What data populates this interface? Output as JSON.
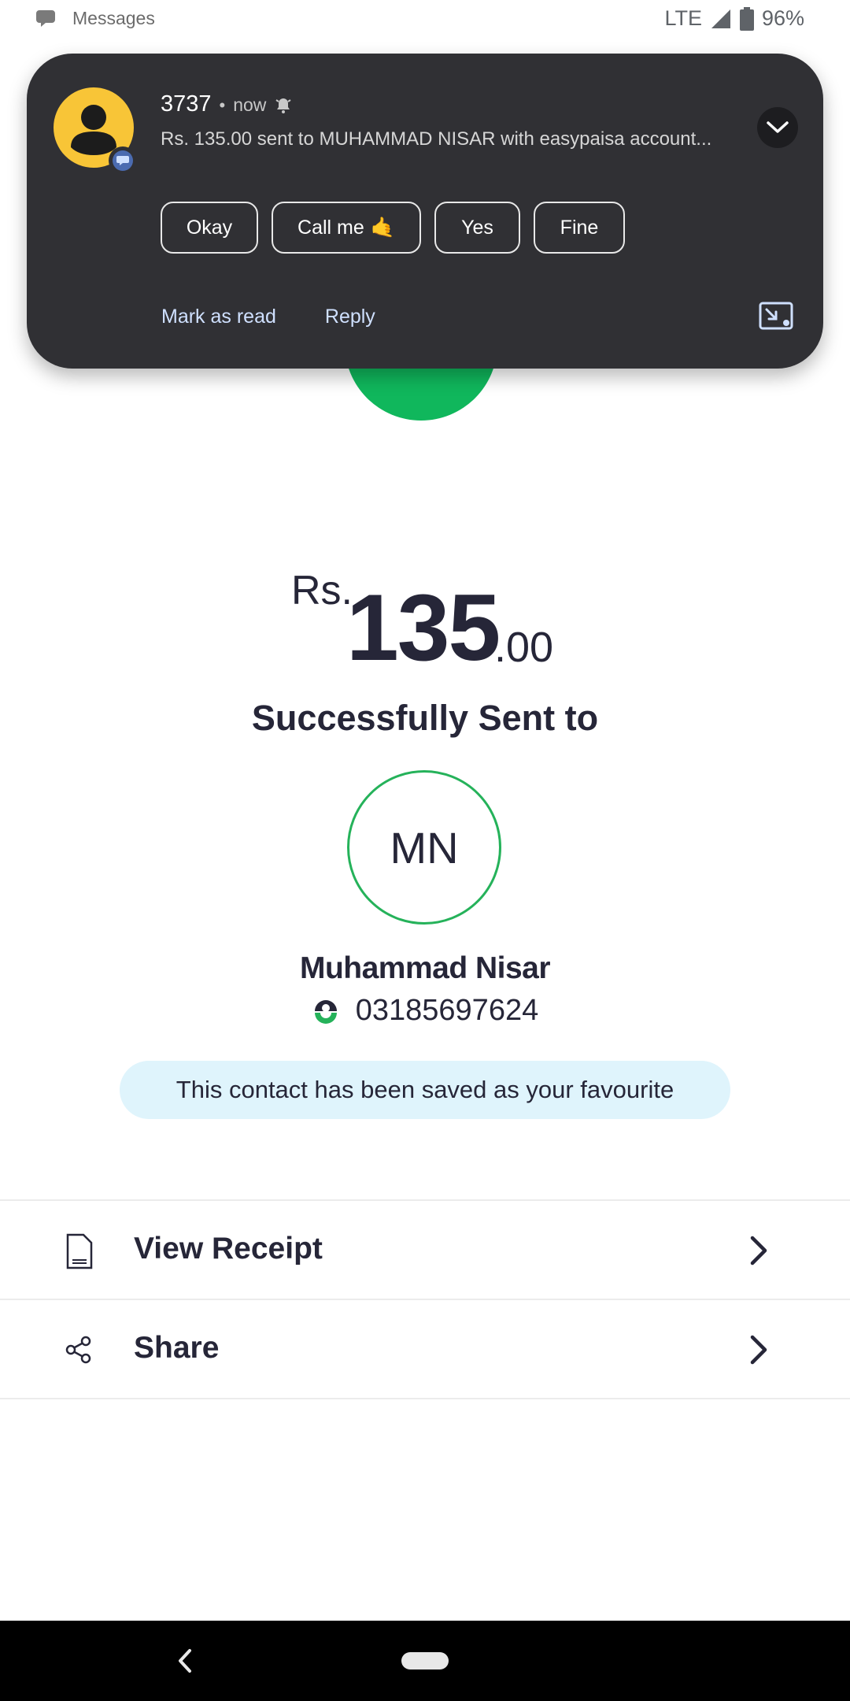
{
  "status_bar": {
    "app_name": "Messages",
    "network": "LTE",
    "battery": "96%",
    "icons": [
      "messages-app-icon",
      "signal-icon",
      "battery-icon"
    ]
  },
  "notification": {
    "sender": "3737",
    "separator": "•",
    "time": "now",
    "body": "Rs. 135.00 sent to MUHAMMAD NISAR with easypaisa account...",
    "smart_replies": [
      "Okay",
      "Call me",
      "Yes",
      "Fine"
    ],
    "call_me_emoji": "🤙",
    "actions": {
      "mark_as_read": "Mark as read",
      "reply": "Reply"
    },
    "icons": [
      "contact-avatar-icon",
      "alert-bell-icon",
      "expand-chevron-icon",
      "picture-in-picture-icon"
    ]
  },
  "amount": {
    "currency": "Rs.",
    "whole": "135",
    "decimal": ".00"
  },
  "status_title": "Successfully Sent to",
  "recipient": {
    "initials": "MN",
    "name": "Muhammad Nisar",
    "phone": "03185697624"
  },
  "favourite_message": "This contact has been saved as your favourite",
  "menu": {
    "view_receipt": "View Receipt",
    "share": "Share"
  },
  "colors": {
    "notification_bg": "#303034",
    "success_green": "#10b75c",
    "initials_ring": "#25b25a",
    "favourite_bg": "#dff4fc",
    "text_dark": "#262638"
  }
}
